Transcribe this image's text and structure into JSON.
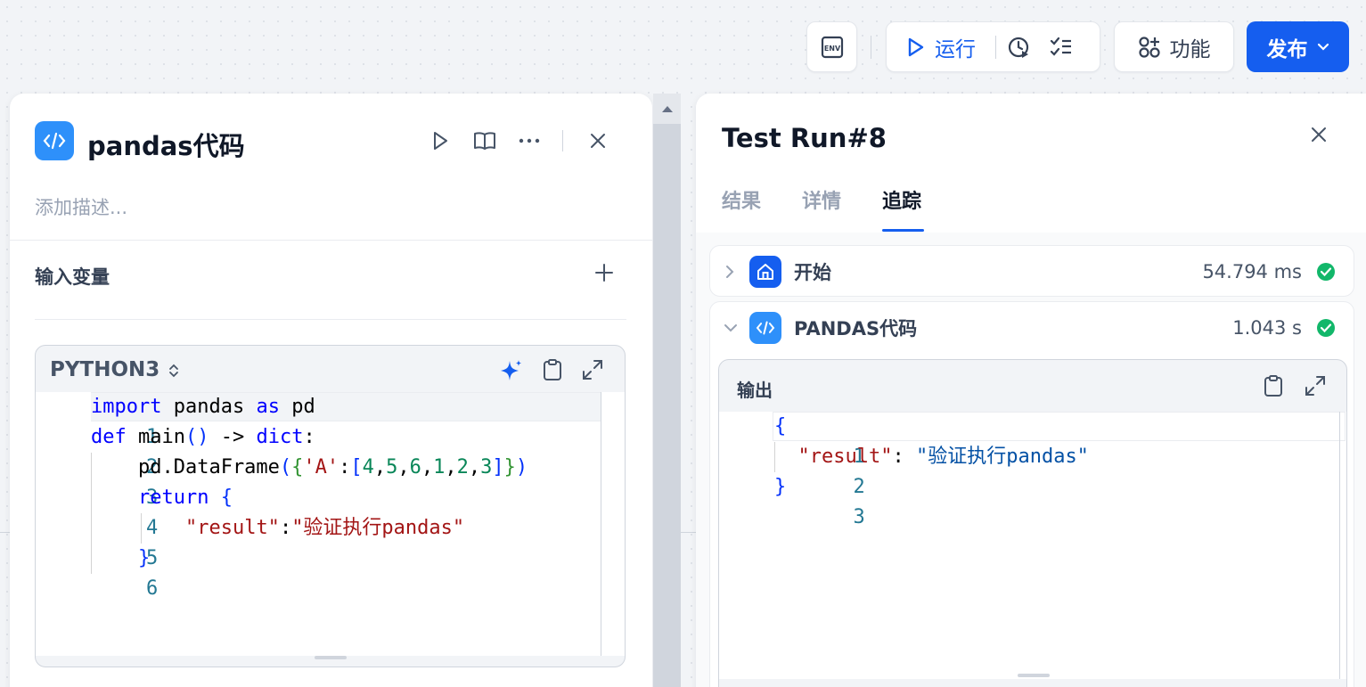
{
  "toolbar": {
    "env_label": "ENV",
    "run_label": "运行",
    "features_label": "功能",
    "publish_label": "发布"
  },
  "node_panel": {
    "title": "pandas代码",
    "description_placeholder": "添加描述...",
    "input_variables_label": "输入变量",
    "code_language": "PYTHON3",
    "code_lines": [
      "import pandas as pd",
      "def main() -> dict:",
      "    pd.DataFrame({'A':[4,5,6,1,2,3]})",
      "    return {",
      "        \"result\":\"验证执行pandas\"",
      "    }"
    ],
    "line_numbers": [
      "1",
      "2",
      "3",
      "4",
      "5",
      "6"
    ]
  },
  "run_panel": {
    "title": "Test Run#8",
    "tabs": [
      "结果",
      "详情",
      "追踪"
    ],
    "active_tab": "追踪",
    "trace": [
      {
        "name": "开始",
        "time": "54.794 ms",
        "status": "success",
        "expanded": false
      },
      {
        "name": "PANDAS代码",
        "time": "1.043 s",
        "status": "success",
        "expanded": true
      }
    ],
    "output_label": "输出",
    "output_lines": [
      "{",
      "  \"result\": \"验证执行pandas\"",
      "}"
    ],
    "output_line_numbers": [
      "1",
      "2",
      "3"
    ]
  },
  "colors": {
    "accent": "#155eef",
    "node_icon": "#2e90fa",
    "success": "#12b76a"
  }
}
